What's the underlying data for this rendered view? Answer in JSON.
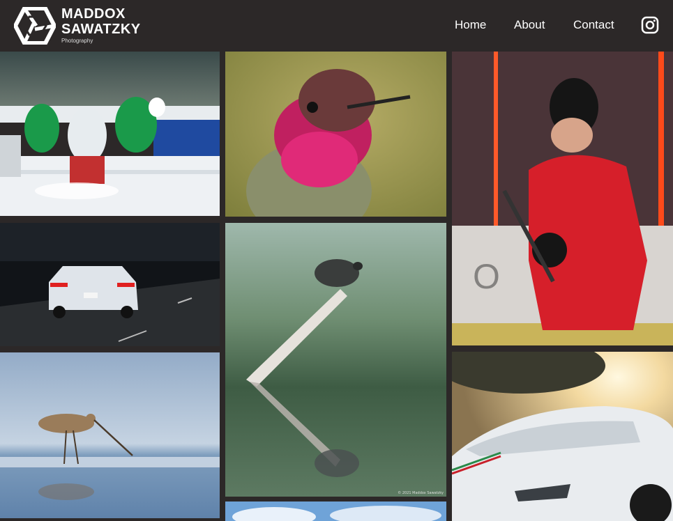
{
  "brand": {
    "line1": "MADDOX",
    "line2": "SAWATZKY",
    "tagline": "Photography"
  },
  "nav": {
    "items": [
      "Home",
      "About",
      "Contact"
    ],
    "instagram_icon": "instagram-icon"
  },
  "colors": {
    "background": "#2c2828",
    "text": "#ffffff"
  },
  "gallery": {
    "photos": [
      {
        "subject": "hockey-game-action"
      },
      {
        "subject": "hummingbird-closeup"
      },
      {
        "subject": "hockey-player-portrait"
      },
      {
        "subject": "car-on-highway-night"
      },
      {
        "subject": "turtle-on-branch",
        "watermark": "© 2021 Maddox Sawatzky"
      },
      {
        "subject": "shorebird-in-water"
      },
      {
        "subject": "white-sports-car-sunset"
      },
      {
        "subject": "sky-clouds"
      }
    ]
  }
}
